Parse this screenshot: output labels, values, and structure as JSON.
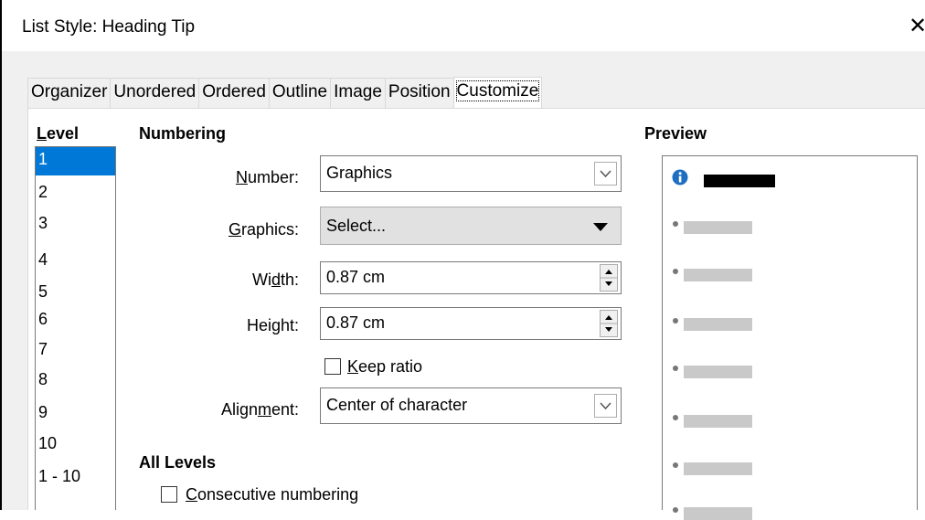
{
  "window": {
    "title": "List Style: Heading Tip",
    "close_glyph": "✕"
  },
  "tabs": [
    {
      "label": "Organizer",
      "active": false
    },
    {
      "label": "Unordered",
      "active": false
    },
    {
      "label": "Ordered",
      "active": false
    },
    {
      "label": "Outline",
      "active": false
    },
    {
      "label": "Image",
      "active": false
    },
    {
      "label": "Position",
      "active": false
    },
    {
      "label": "Customize",
      "active": true
    }
  ],
  "level": {
    "heading": "Level",
    "items": [
      "1",
      "2",
      "3",
      "4",
      "5",
      "6",
      "7",
      "8",
      "9",
      "10",
      "1 - 10"
    ],
    "selected": "1"
  },
  "numbering": {
    "heading": "Numbering",
    "number_label": "Number:",
    "number_value": "Graphics",
    "graphics_label": "Graphics:",
    "graphics_value": "Select...",
    "width_label": "Width:",
    "width_value": "0.87 cm",
    "height_label": "Height:",
    "height_value": "0.87 cm",
    "keep_ratio_label": "Keep ratio",
    "keep_ratio_checked": false,
    "alignment_label": "Alignment:",
    "alignment_value": "Center of character"
  },
  "all_levels": {
    "heading": "All Levels",
    "consecutive_label": "Consecutive numbering",
    "consecutive_checked": false
  },
  "preview": {
    "heading": "Preview",
    "first_bullet_icon": "info-icon",
    "accent": "#0078d7"
  }
}
